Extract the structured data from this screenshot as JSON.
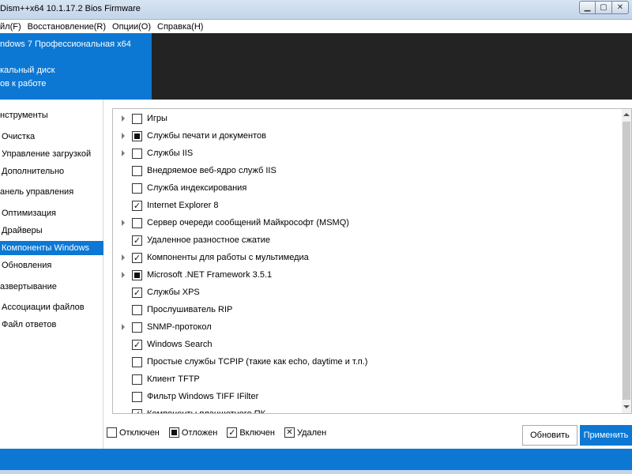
{
  "window": {
    "title": "Dism++x64 10.1.17.2 Bios Firmware",
    "min_icon": "minimize-icon",
    "max_icon": "maximize-icon",
    "close_icon": "close-icon"
  },
  "menu": [
    "йл(F)",
    "Восстановление(R)",
    "Опции(O)",
    "Справка(H)"
  ],
  "header": {
    "os": "ndows 7 Профессиональная x64",
    "disk": "кальный диск",
    "status": "ов к работе"
  },
  "sidebar": [
    {
      "label": "нструменты",
      "type": "category"
    },
    {
      "label": "Очистка",
      "type": "item"
    },
    {
      "label": "Управление загрузкой",
      "type": "item"
    },
    {
      "label": "Дополнительно",
      "type": "item"
    },
    {
      "label": "анель управления",
      "type": "category"
    },
    {
      "label": "Оптимизация",
      "type": "item"
    },
    {
      "label": "Драйверы",
      "type": "item"
    },
    {
      "label": "Компоненты Windows",
      "type": "item",
      "selected": true
    },
    {
      "label": "Обновления",
      "type": "item"
    },
    {
      "label": "азвертывание",
      "type": "category"
    },
    {
      "label": "Ассоциации файлов",
      "type": "item"
    },
    {
      "label": "Файл ответов",
      "type": "item"
    }
  ],
  "features": [
    {
      "label": "Игры",
      "state": "off",
      "expandable": true
    },
    {
      "label": "Службы печати и документов",
      "state": "partial",
      "expandable": true
    },
    {
      "label": "Службы IIS",
      "state": "off",
      "expandable": true
    },
    {
      "label": "Внедряемое веб-ядро служб IIS",
      "state": "off",
      "expandable": false
    },
    {
      "label": "Служба индексирования",
      "state": "off",
      "expandable": false
    },
    {
      "label": "Internet Explorer 8",
      "state": "on",
      "expandable": false
    },
    {
      "label": "Сервер очереди сообщений Майкрософт (MSMQ)",
      "state": "off",
      "expandable": true
    },
    {
      "label": "Удаленное разностное сжатие",
      "state": "on",
      "expandable": false
    },
    {
      "label": "Компоненты для работы с мультимедиа",
      "state": "on",
      "expandable": true
    },
    {
      "label": "Microsoft .NET Framework 3.5.1",
      "state": "partial",
      "expandable": true
    },
    {
      "label": "Службы XPS",
      "state": "on",
      "expandable": false
    },
    {
      "label": "Прослушиватель RIP",
      "state": "off",
      "expandable": false
    },
    {
      "label": "SNMP-протокол",
      "state": "off",
      "expandable": true
    },
    {
      "label": "Windows Search",
      "state": "on",
      "expandable": false
    },
    {
      "label": "Простые службы TCPIP (такие как echo, daytime и т.п.)",
      "state": "off",
      "expandable": false
    },
    {
      "label": "Клиент TFTP",
      "state": "off",
      "expandable": false
    },
    {
      "label": "Фильтр Windows TIFF IFilter",
      "state": "off",
      "expandable": false
    },
    {
      "label": "Компоненты планшетного ПК",
      "state": "on",
      "expandable": false
    }
  ],
  "legend": {
    "off": "Отключен",
    "partial": "Отложен",
    "on": "Включен",
    "deleted": "Удален"
  },
  "buttons": {
    "refresh": "Обновить",
    "apply": "Применить"
  }
}
